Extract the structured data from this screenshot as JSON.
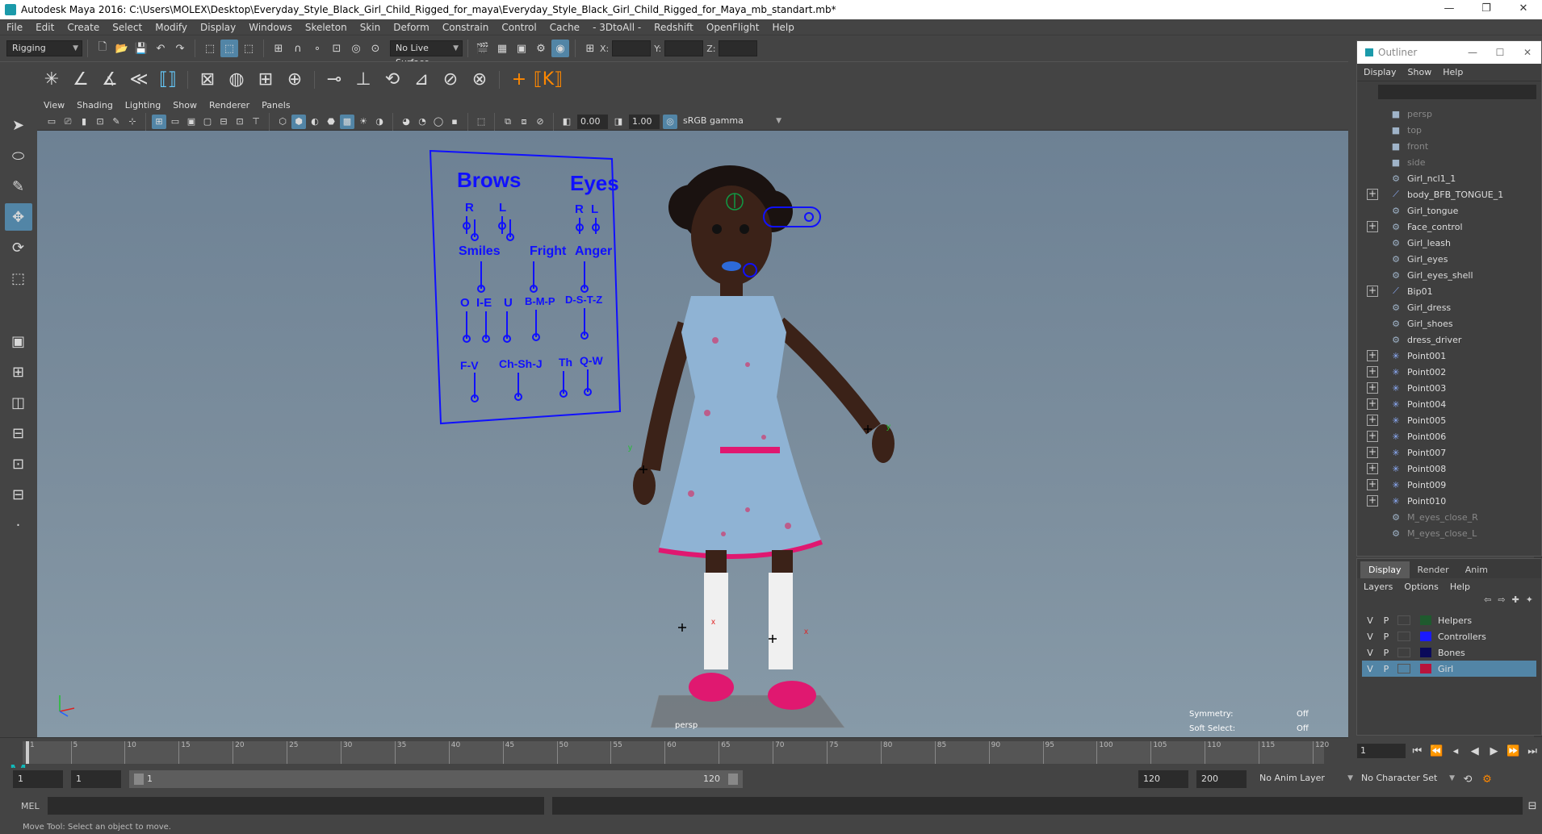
{
  "window": {
    "title": "Autodesk Maya 2016: C:\\Users\\MOLEX\\Desktop\\Everyday_Style_Black_Girl_Child_Rigged_for_maya\\Everyday_Style_Black_Girl_Child_Rigged_for_Maya_mb_standart.mb*"
  },
  "menubar": [
    "File",
    "Edit",
    "Create",
    "Select",
    "Modify",
    "Display",
    "Windows",
    "Skeleton",
    "Skin",
    "Deform",
    "Constrain",
    "Control",
    "Cache",
    "- 3DtoAll -",
    "Redshift",
    "OpenFlight",
    "Help"
  ],
  "status": {
    "mode": "Rigging",
    "live_surface": "No Live Surface",
    "x_label": "X:",
    "y_label": "Y:",
    "z_label": "Z:"
  },
  "panel_menu": [
    "View",
    "Shading",
    "Lighting",
    "Show",
    "Renderer",
    "Panels"
  ],
  "panel_toolbar": {
    "exposure": "0.00",
    "gamma": "1.00",
    "color_space": "sRGB gamma"
  },
  "viewport": {
    "camera_label": "persp",
    "symmetry_label": "Symmetry:",
    "symmetry_value": "Off",
    "soft_select_label": "Soft Select:",
    "soft_select_value": "Off",
    "face_panel": {
      "brows": "Brows",
      "eyes": "Eyes",
      "r1": "R",
      "l1": "L",
      "r2": "R",
      "l2": "L",
      "smiles": "Smiles",
      "fright": "Fright",
      "anger": "Anger",
      "o": "O",
      "ie": "I-E",
      "u": "U",
      "bmp": "B-M-P",
      "dstz": "D-S-T-Z",
      "fv": "F-V",
      "chshj": "Ch-Sh-J",
      "th": "Th",
      "qw": "Q-W"
    }
  },
  "outliner": {
    "title": "Outliner",
    "menu": [
      "Display",
      "Show",
      "Help"
    ],
    "items": [
      {
        "label": "persp",
        "dim": true,
        "expand": false,
        "icon": "camera-icon"
      },
      {
        "label": "top",
        "dim": true,
        "expand": false,
        "icon": "camera-icon"
      },
      {
        "label": "front",
        "dim": true,
        "expand": false,
        "icon": "camera-icon"
      },
      {
        "label": "side",
        "dim": true,
        "expand": false,
        "icon": "camera-icon"
      },
      {
        "label": "Girl_ncl1_1",
        "dim": false,
        "expand": false,
        "icon": "mesh-icon"
      },
      {
        "label": "body_BFB_TONGUE_1",
        "dim": false,
        "expand": true,
        "icon": "joint-icon"
      },
      {
        "label": "Girl_tongue",
        "dim": false,
        "expand": false,
        "icon": "mesh-icon"
      },
      {
        "label": "Face_control",
        "dim": false,
        "expand": true,
        "icon": "mesh-icon"
      },
      {
        "label": "Girl_leash",
        "dim": false,
        "expand": false,
        "icon": "mesh-icon"
      },
      {
        "label": "Girl_eyes",
        "dim": false,
        "expand": false,
        "icon": "mesh-icon"
      },
      {
        "label": "Girl_eyes_shell",
        "dim": false,
        "expand": false,
        "icon": "mesh-icon"
      },
      {
        "label": "Bip01",
        "dim": false,
        "expand": true,
        "icon": "joint-icon"
      },
      {
        "label": "Girl_dress",
        "dim": false,
        "expand": false,
        "icon": "mesh-icon"
      },
      {
        "label": "Girl_shoes",
        "dim": false,
        "expand": false,
        "icon": "mesh-icon"
      },
      {
        "label": "dress_driver",
        "dim": false,
        "expand": false,
        "icon": "mesh-icon"
      },
      {
        "label": "Point001",
        "dim": false,
        "expand": true,
        "icon": "locator-icon"
      },
      {
        "label": "Point002",
        "dim": false,
        "expand": true,
        "icon": "locator-icon"
      },
      {
        "label": "Point003",
        "dim": false,
        "expand": true,
        "icon": "locator-icon"
      },
      {
        "label": "Point004",
        "dim": false,
        "expand": true,
        "icon": "locator-icon"
      },
      {
        "label": "Point005",
        "dim": false,
        "expand": true,
        "icon": "locator-icon"
      },
      {
        "label": "Point006",
        "dim": false,
        "expand": true,
        "icon": "locator-icon"
      },
      {
        "label": "Point007",
        "dim": false,
        "expand": true,
        "icon": "locator-icon"
      },
      {
        "label": "Point008",
        "dim": false,
        "expand": true,
        "icon": "locator-icon"
      },
      {
        "label": "Point009",
        "dim": false,
        "expand": true,
        "icon": "locator-icon"
      },
      {
        "label": "Point010",
        "dim": false,
        "expand": true,
        "icon": "locator-icon"
      },
      {
        "label": "M_eyes_close_R",
        "dim": true,
        "expand": false,
        "icon": "mesh-icon"
      },
      {
        "label": "M_eyes_close_L",
        "dim": true,
        "expand": false,
        "icon": "mesh-icon"
      }
    ]
  },
  "layers": {
    "tabs": [
      "Display",
      "Render",
      "Anim"
    ],
    "menu": [
      "Layers",
      "Options",
      "Help"
    ],
    "rows": [
      {
        "v": "V",
        "p": "P",
        "name": "Helpers",
        "color": "#1f5a2e",
        "selected": false
      },
      {
        "v": "V",
        "p": "P",
        "name": "Controllers",
        "color": "#1a1aff",
        "selected": false
      },
      {
        "v": "V",
        "p": "P",
        "name": "Bones",
        "color": "#0a0a5a",
        "selected": false
      },
      {
        "v": "V",
        "p": "P",
        "name": "Girl",
        "color": "#b8143c",
        "selected": true
      }
    ]
  },
  "timeline": {
    "ticks": [
      "1",
      "5",
      "10",
      "15",
      "20",
      "25",
      "30",
      "35",
      "40",
      "45",
      "50",
      "55",
      "60",
      "65",
      "70",
      "75",
      "80",
      "85",
      "90",
      "95",
      "100",
      "105",
      "110",
      "115",
      "120"
    ],
    "current_frame": "1"
  },
  "range": {
    "start": "1",
    "anim_start": "1",
    "slider_start": "1",
    "slider_end": "120",
    "anim_end": "120",
    "end": "200",
    "anim_layer": "No Anim Layer",
    "character_set": "No Character Set"
  },
  "command": {
    "lang": "MEL"
  },
  "help_line": "Move Tool: Select an object to move."
}
